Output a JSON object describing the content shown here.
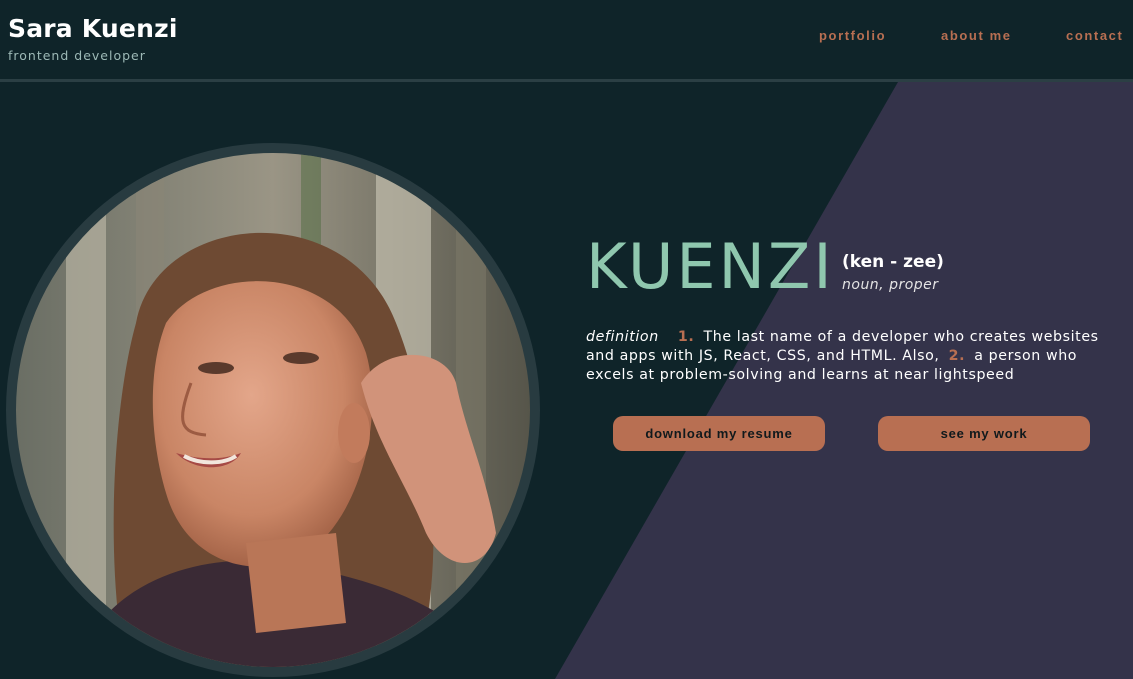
{
  "header": {
    "name": "Sara Kuenzi",
    "subtitle": "frontend developer",
    "nav": [
      {
        "label": "portfolio"
      },
      {
        "label": "about me"
      },
      {
        "label": "contact"
      }
    ]
  },
  "hero": {
    "photo_alt": "portrait of Sara Kuenzi",
    "word": "KUENZI",
    "pronunciation": "(ken - zee)",
    "part_of_speech": "noun, proper",
    "definition": {
      "label": "definition",
      "num1": "1.",
      "text1": "The last name of a developer who creates websites and apps with JS, React, CSS, and HTML. Also,",
      "num2": "2.",
      "text2": "a person who excels at problem-solving and learns at near lightspeed"
    },
    "buttons": {
      "resume": "download my resume",
      "work": "see my work"
    }
  },
  "colors": {
    "background": "#0f2429",
    "panel": "#34334a",
    "accent": "#b86f52",
    "headline": "#8fc7ae"
  }
}
